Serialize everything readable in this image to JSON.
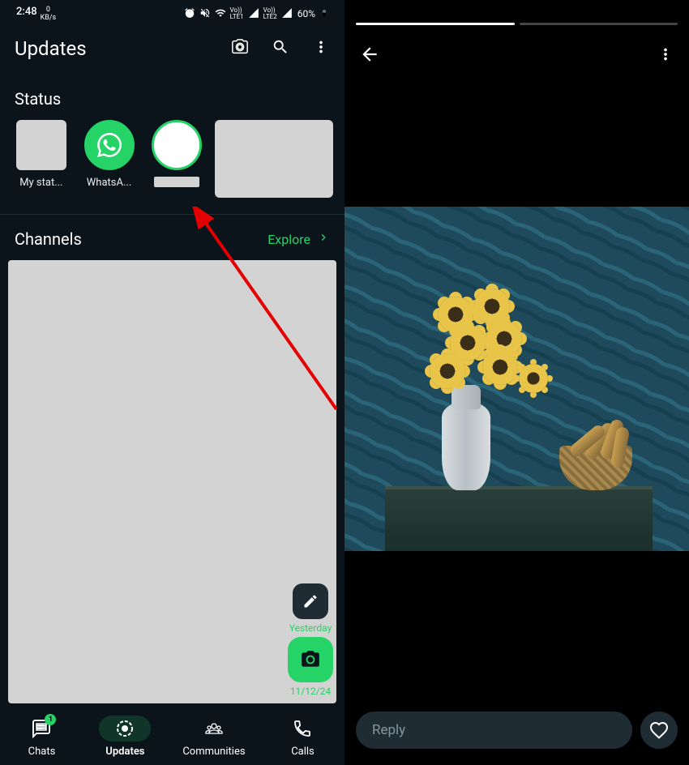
{
  "statusBar": {
    "time": "2:48",
    "speed_num": "0",
    "speed_unit": "KB/s",
    "lte1": "Vo))\nLTE1",
    "lte2": "Vo))\nLTE2",
    "battery": "60%"
  },
  "toolbar": {
    "title": "Updates"
  },
  "status": {
    "section_title": "Status",
    "items": [
      {
        "label": "My stat..."
      },
      {
        "label": "WhatsA..."
      }
    ]
  },
  "channels": {
    "title": "Channels",
    "explore": "Explore"
  },
  "fab": {
    "date_yesterday": "Yesterday",
    "date_value": "11/12/24"
  },
  "nav": {
    "chats": {
      "label": "Chats",
      "badge": "1"
    },
    "updates": {
      "label": "Updates"
    },
    "communities": {
      "label": "Communities"
    },
    "calls": {
      "label": "Calls"
    }
  },
  "story": {
    "reply_placeholder": "Reply"
  }
}
